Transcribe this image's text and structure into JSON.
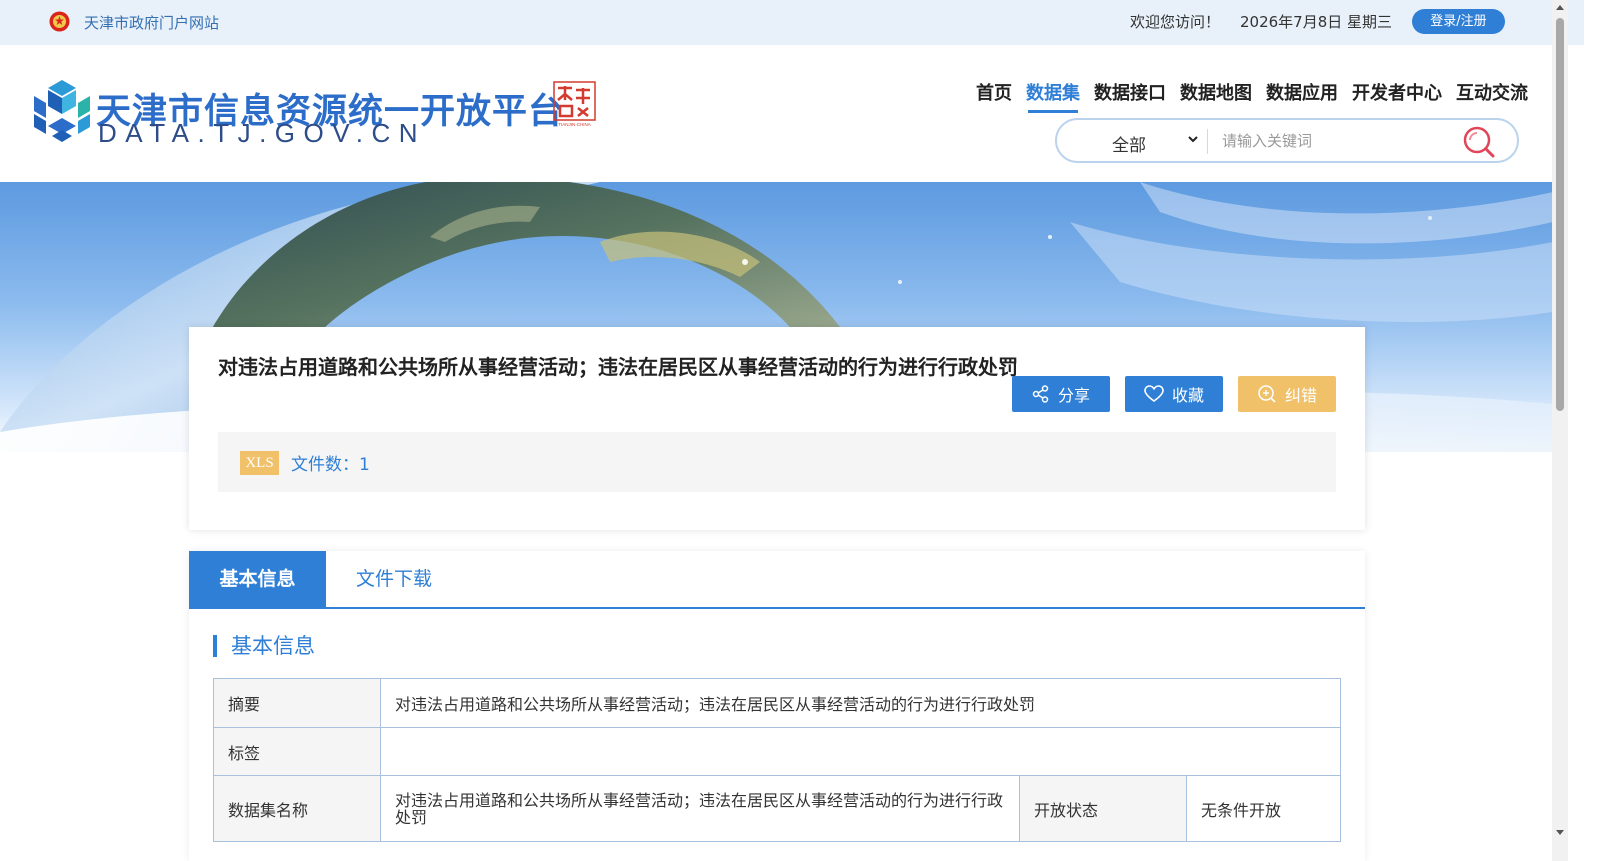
{
  "topbar": {
    "gov_portal": "天津市政府门户网站",
    "welcome": "欢迎您访问！",
    "date": "2026年7月8日 星期三",
    "login": "登录/注册"
  },
  "logo": {
    "title": "天津市信息资源统一开放平台",
    "domain": "DATA.TJ.GOV.CN",
    "seal_text": "天津",
    "seal_caption": "TIANJIN·CHINA"
  },
  "nav": {
    "items": [
      {
        "label": "首页",
        "active": false
      },
      {
        "label": "数据集",
        "active": true
      },
      {
        "label": "数据接口",
        "active": false
      },
      {
        "label": "数据地图",
        "active": false
      },
      {
        "label": "数据应用",
        "active": false
      },
      {
        "label": "开发者中心",
        "active": false
      },
      {
        "label": "互动交流",
        "active": false
      }
    ]
  },
  "search": {
    "scope": "全部",
    "placeholder": "请输入关键词"
  },
  "dataset": {
    "title": "对违法占用道路和公共场所从事经营活动；违法在居民区从事经营活动的行为进行行政处罚",
    "actions": {
      "share": "分享",
      "favorite": "收藏",
      "report_error": "纠错"
    },
    "file_type": "XLS",
    "file_count": "文件数：1"
  },
  "tabs": [
    {
      "label": "基本信息",
      "active": true
    },
    {
      "label": "文件下载",
      "active": false
    }
  ],
  "section_title": "基本信息",
  "info": {
    "summary_label": "摘要",
    "summary_value": "对违法占用道路和公共场所从事经营活动；违法在居民区从事经营活动的行为进行行政处罚",
    "tags_label": "标签",
    "tags_value": "",
    "name_label": "数据集名称",
    "name_value": "对违法占用道路和公共场所从事经营活动；违法在居民区从事经营活动的行为进行行政处罚",
    "status_label": "开放状态",
    "status_value": "无条件开放"
  },
  "colors": {
    "primary": "#2f7fd6",
    "accent_yellow": "#f0c169",
    "topbar_bg": "#e8f0f9"
  }
}
